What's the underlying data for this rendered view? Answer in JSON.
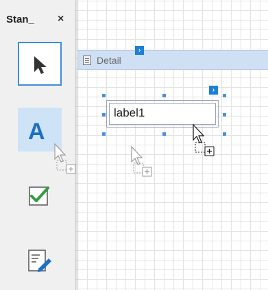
{
  "toolbox": {
    "title": "Stan_",
    "close_glyph": "×",
    "tools": [
      {
        "name": "pointer-tool",
        "icon": "arrow-pointer-icon",
        "selected": true
      },
      {
        "name": "label-tool",
        "icon": "label-a-icon",
        "glyph": "A",
        "highlighted": true
      },
      {
        "name": "checkbox-tool",
        "icon": "checkbox-icon"
      },
      {
        "name": "richtext-tool",
        "icon": "edit-document-icon"
      }
    ]
  },
  "band": {
    "label": "Detail",
    "icon": "band-document-icon",
    "smart_tag_glyph": "›"
  },
  "label_control": {
    "text": "label1",
    "smart_tag_glyph": "›"
  },
  "colors": {
    "accent": "#3c8de0",
    "band_bg": "#cfdff4",
    "toolbox_bg": "#f0f0f0",
    "handle": "#4a90d9"
  }
}
